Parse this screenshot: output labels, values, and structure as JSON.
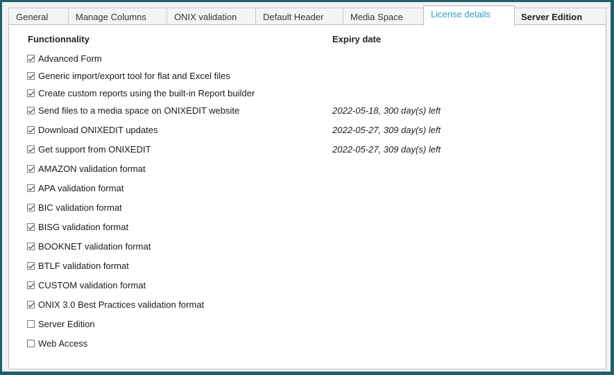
{
  "tabs": [
    {
      "label": "General",
      "active": false
    },
    {
      "label": "Manage Columns",
      "active": false
    },
    {
      "label": "ONIX validation",
      "active": false
    },
    {
      "label": "Default Header",
      "active": false
    },
    {
      "label": "Media Space",
      "active": false
    },
    {
      "label": "License details",
      "active": true
    },
    {
      "label": "Server Edition",
      "active": false
    }
  ],
  "columns": {
    "functionality": "Functionnality",
    "expiry": "Expiry date"
  },
  "features": [
    {
      "label": "Advanced Form",
      "checked": true,
      "expiry": ""
    },
    {
      "label": "Generic import/export tool for flat and Excel files",
      "checked": true,
      "expiry": ""
    },
    {
      "label": "Create custom reports using the built-in Report builder",
      "checked": true,
      "expiry": ""
    },
    {
      "label": "Send files to a media space on ONIXEDIT website",
      "checked": true,
      "expiry": "2022-05-18, 300 day(s) left"
    },
    {
      "label": "Download ONIXEDIT updates",
      "checked": true,
      "expiry": "2022-05-27, 309 day(s) left"
    },
    {
      "label": "Get support from ONIXEDIT",
      "checked": true,
      "expiry": "2022-05-27, 309 day(s) left"
    },
    {
      "label": "AMAZON validation format",
      "checked": true,
      "expiry": ""
    },
    {
      "label": "APA validation format",
      "checked": true,
      "expiry": ""
    },
    {
      "label": "BIC validation format",
      "checked": true,
      "expiry": ""
    },
    {
      "label": "BISG validation format",
      "checked": true,
      "expiry": ""
    },
    {
      "label": "BOOKNET validation format",
      "checked": true,
      "expiry": ""
    },
    {
      "label": "BTLF validation format",
      "checked": true,
      "expiry": ""
    },
    {
      "label": "CUSTOM validation format",
      "checked": true,
      "expiry": ""
    },
    {
      "label": "ONIX 3.0 Best Practices validation format",
      "checked": true,
      "expiry": ""
    },
    {
      "label": "Server Edition",
      "checked": false,
      "expiry": ""
    },
    {
      "label": "Web Access",
      "checked": false,
      "expiry": ""
    }
  ]
}
